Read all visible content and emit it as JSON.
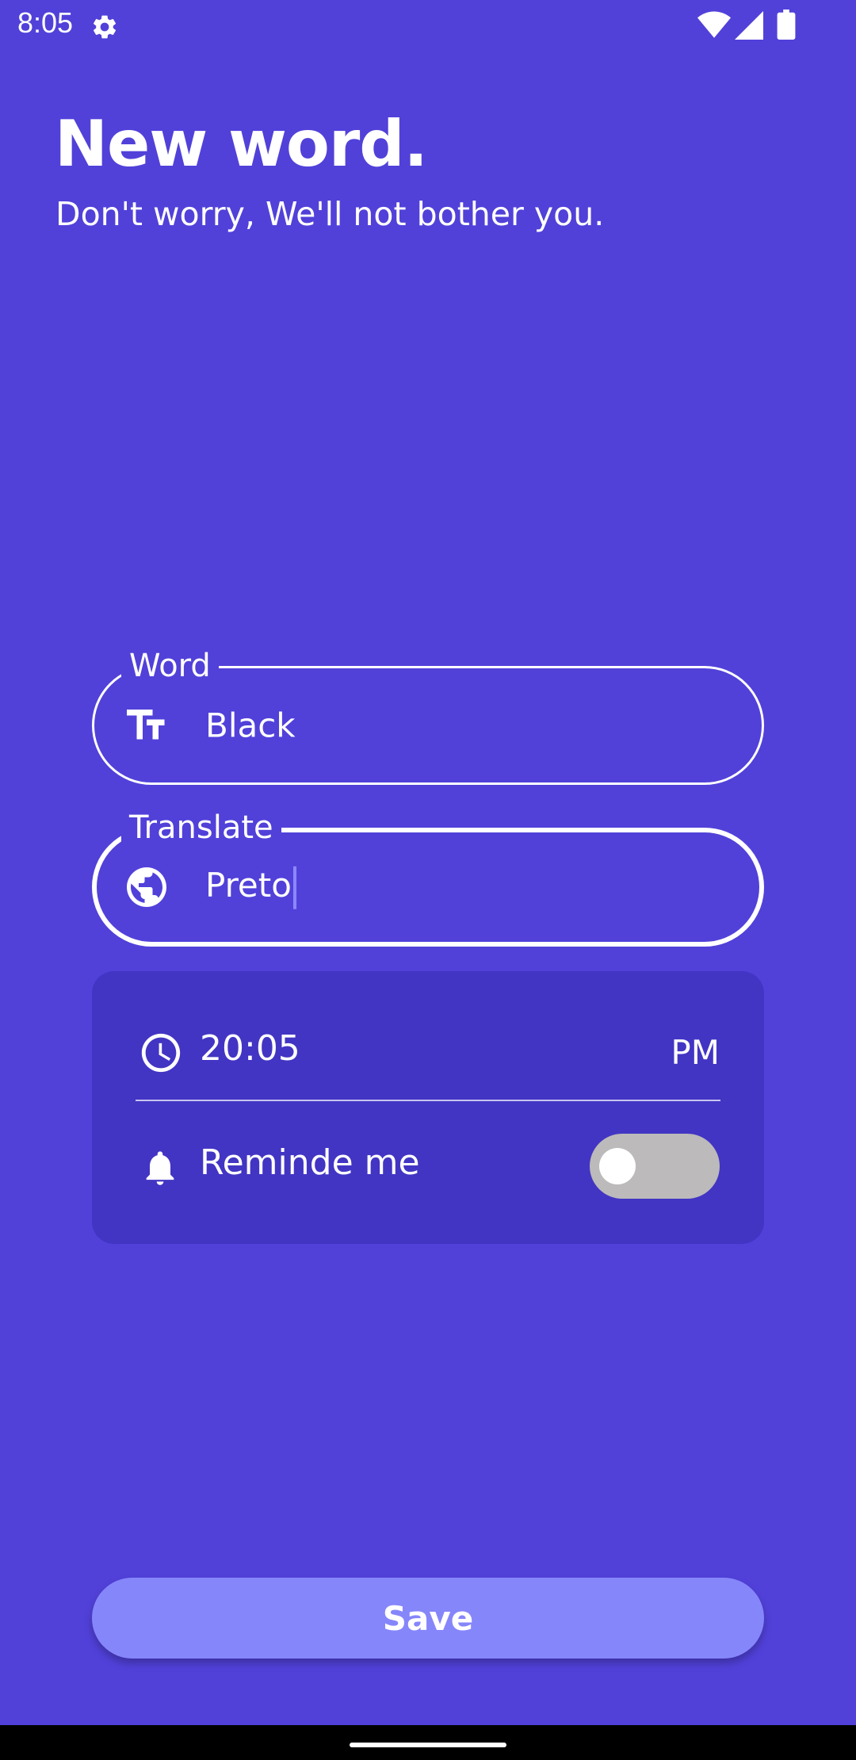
{
  "status_bar": {
    "time": "8:05",
    "icons": [
      "gear-icon",
      "wifi-icon",
      "signal-icon",
      "battery-icon"
    ]
  },
  "header": {
    "title": "New word.",
    "subtitle": "Don't worry, We'll not bother you."
  },
  "form": {
    "word": {
      "label": "Word",
      "value": "Black",
      "icon": "text-size-icon"
    },
    "translate": {
      "label": "Translate",
      "value": "Preto",
      "icon": "globe-icon"
    }
  },
  "reminder": {
    "time": "20:05",
    "period": "PM",
    "remind_label": "Reminde me",
    "remind_enabled": false
  },
  "actions": {
    "save_label": "Save"
  },
  "colors": {
    "background": "#5141d9",
    "card": "#4235c3",
    "button": "#8686fb",
    "toggle_off": "#bcbaba",
    "caret": "#8b87ff"
  }
}
